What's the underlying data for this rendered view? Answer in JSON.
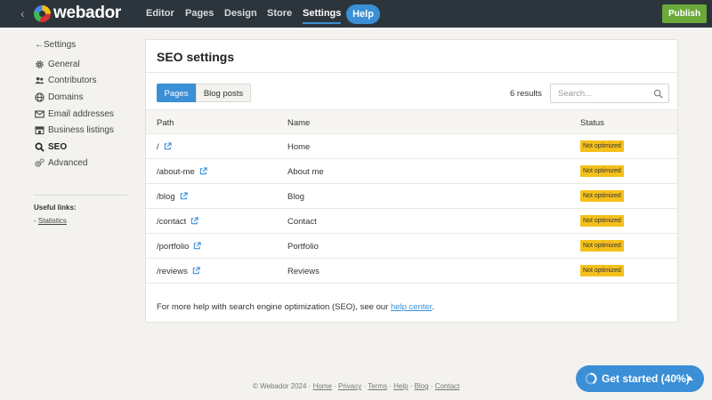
{
  "topbar": {
    "logo_text": "webador",
    "nav": [
      {
        "label": "Editor",
        "active": false
      },
      {
        "label": "Pages",
        "active": false
      },
      {
        "label": "Design",
        "active": false
      },
      {
        "label": "Store",
        "active": false
      },
      {
        "label": "Settings",
        "active": true
      }
    ],
    "help_label": "Help",
    "publish_label": "Publish",
    "colors": {
      "bar": "#2d353c",
      "accent": "#3a8fd6",
      "publish": "#6aa93a"
    }
  },
  "sidebar": {
    "back_label": "Settings",
    "items": [
      {
        "label": "General",
        "icon": "gear-icon",
        "active": false
      },
      {
        "label": "Contributors",
        "icon": "users-icon",
        "active": false
      },
      {
        "label": "Domains",
        "icon": "globe-icon",
        "active": false
      },
      {
        "label": "Email addresses",
        "icon": "envelope-icon",
        "active": false
      },
      {
        "label": "Business listings",
        "icon": "storefront-icon",
        "active": false
      },
      {
        "label": "SEO",
        "icon": "search-icon",
        "active": true
      },
      {
        "label": "Advanced",
        "icon": "gears-icon",
        "active": false
      }
    ],
    "useful_links_label": "Useful links:",
    "useful_links": [
      {
        "prefix": "- ",
        "label": "Statistics"
      }
    ]
  },
  "main": {
    "title": "SEO settings",
    "tabs": [
      {
        "label": "Pages",
        "active": true
      },
      {
        "label": "Blog posts",
        "active": false
      }
    ],
    "results_text": "6 results",
    "search": {
      "placeholder": "Search..."
    },
    "table": {
      "columns": [
        "Path",
        "Name",
        "Status"
      ],
      "rows": [
        {
          "path": "/",
          "name": "Home",
          "status": "Not optimized"
        },
        {
          "path": "/about-me",
          "name": "About me",
          "status": "Not optimized"
        },
        {
          "path": "/blog",
          "name": "Blog",
          "status": "Not optimized"
        },
        {
          "path": "/contact",
          "name": "Contact",
          "status": "Not optimized"
        },
        {
          "path": "/portfolio",
          "name": "Portfolio",
          "status": "Not optimized"
        },
        {
          "path": "/reviews",
          "name": "Reviews",
          "status": "Not optimized"
        }
      ],
      "status_color": "#f4c01b"
    },
    "help_note": {
      "text": "For more help with search engine optimization (SEO), see our ",
      "link": "help center",
      "suffix": "."
    }
  },
  "footer": {
    "copyright": "© Webador 2024 · ",
    "links": [
      "Home",
      "Privacy",
      "Terms",
      "Help",
      "Blog",
      "Contact"
    ],
    "separator": " · "
  },
  "get_started": {
    "label": "Get started (40%)",
    "progress": 0.4
  }
}
